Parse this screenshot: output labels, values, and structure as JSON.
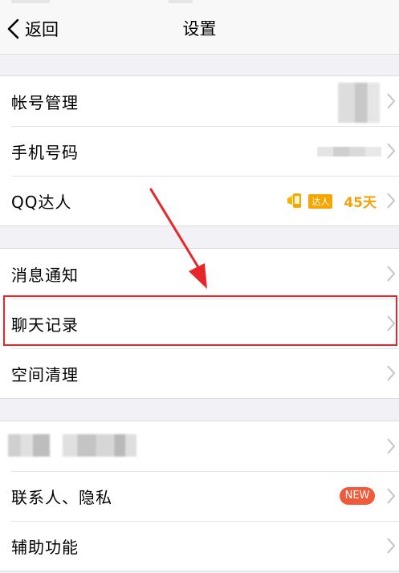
{
  "nav": {
    "back_label": "返回",
    "title": "设置"
  },
  "group1": {
    "items": [
      {
        "label": "帐号管理"
      },
      {
        "label": "手机号码"
      },
      {
        "label": "QQ达人",
        "badge_tag": "达人",
        "days": "45天"
      }
    ]
  },
  "group2": {
    "items": [
      {
        "label": "消息通知"
      },
      {
        "label": "聊天记录"
      },
      {
        "label": "空间清理"
      }
    ]
  },
  "group3": {
    "items": [
      {
        "label": ""
      },
      {
        "label": "联系人、隐私",
        "badge": "NEW"
      },
      {
        "label": "辅助功能"
      }
    ]
  },
  "colors": {
    "highlight": "#e8262a",
    "new_badge": "#f05a3a",
    "daren_accent": "#f2a20a"
  }
}
